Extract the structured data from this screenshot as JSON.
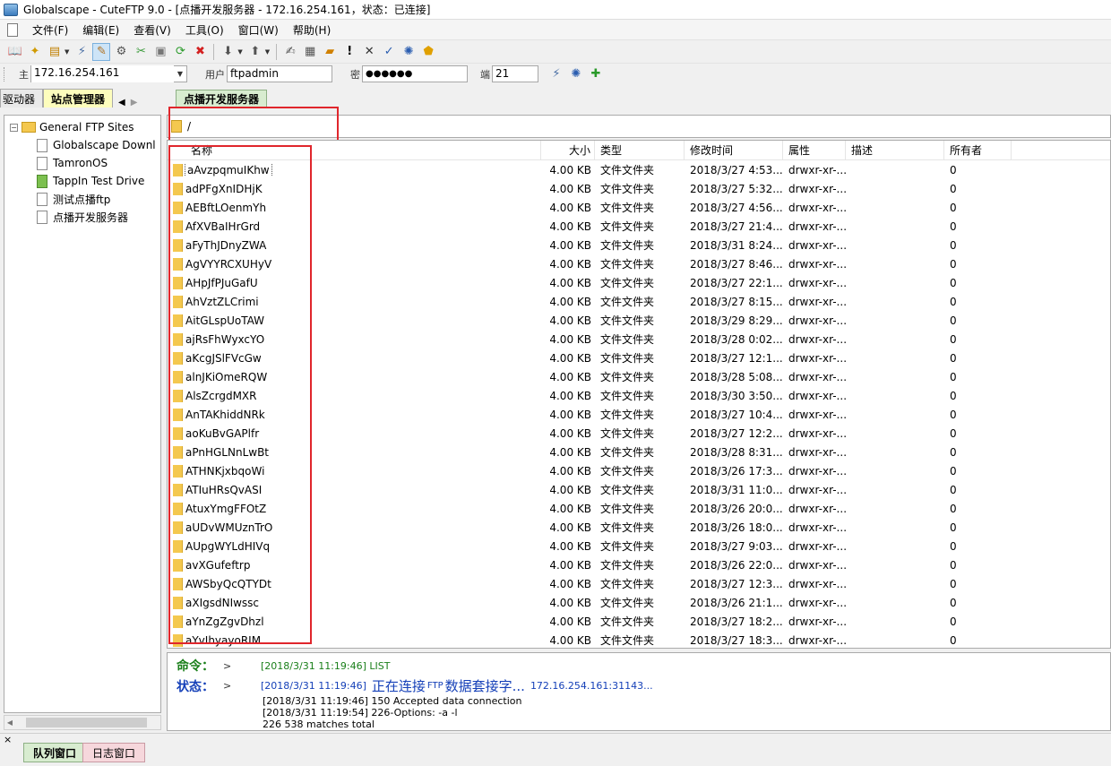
{
  "window": {
    "title": "Globalscape - CuteFTP 9.0 - [点播开发服务器 - 172.16.254.161，状态：已连接]"
  },
  "menu": {
    "items": [
      "文件(F)",
      "编辑(E)",
      "查看(V)",
      "工具(O)",
      "窗口(W)",
      "帮助(H)"
    ]
  },
  "toolbar": {
    "icons": [
      "book-icon",
      "wand-icon",
      "new-site-icon",
      "connect-icon",
      "quick-connect-icon",
      "advanced-icon",
      "tools-icon",
      "disconnect-icon",
      "refresh-icon",
      "stop-icon",
      "download-icon",
      "upload-icon",
      "edit-icon",
      "view-icon",
      "folder-new-icon",
      "exclaim-icon",
      "delete-icon",
      "properties-icon",
      "settings-icon",
      "shield-icon"
    ]
  },
  "quickconnect": {
    "host_label": "主",
    "host_value": "172.16.254.161",
    "user_label": "用户",
    "user_value": "ftpadmin",
    "password_label": "密",
    "password_value": "●●●●●●",
    "port_label": "端",
    "port_value": "21"
  },
  "left_tabs": {
    "tab1": "驱动器",
    "tab2": "站点管理器"
  },
  "tree": {
    "root": "General FTP Sites",
    "items": [
      "Globalscape Downl",
      "TamronOS",
      "TappIn Test Drive",
      "测试点播ftp",
      "点播开发服务器"
    ]
  },
  "right_tab": "点播开发服务器",
  "path": "/",
  "columns": {
    "name": "名称",
    "size": "大小",
    "type": "类型",
    "modified": "修改时间",
    "attr": "属性",
    "desc": "描述",
    "owner": "所有者"
  },
  "files": [
    {
      "name": "aAvzpqmuIKhw",
      "size": "4.00 KB",
      "type": "文件文件夹",
      "modified": "2018/3/27 4:53...",
      "attr": "drwxr-xr-...",
      "owner": "0"
    },
    {
      "name": "adPFgXnIDHjK",
      "size": "4.00 KB",
      "type": "文件文件夹",
      "modified": "2018/3/27 5:32...",
      "attr": "drwxr-xr-...",
      "owner": "0"
    },
    {
      "name": "AEBftLOenmYh",
      "size": "4.00 KB",
      "type": "文件文件夹",
      "modified": "2018/3/27 4:56...",
      "attr": "drwxr-xr-...",
      "owner": "0"
    },
    {
      "name": "AfXVBaIHrGrd",
      "size": "4.00 KB",
      "type": "文件文件夹",
      "modified": "2018/3/27 21:4...",
      "attr": "drwxr-xr-...",
      "owner": "0"
    },
    {
      "name": "aFyThJDnyZWA",
      "size": "4.00 KB",
      "type": "文件文件夹",
      "modified": "2018/3/31 8:24...",
      "attr": "drwxr-xr-...",
      "owner": "0"
    },
    {
      "name": "AgVYYRCXUHyV",
      "size": "4.00 KB",
      "type": "文件文件夹",
      "modified": "2018/3/27 8:46...",
      "attr": "drwxr-xr-...",
      "owner": "0"
    },
    {
      "name": "AHpJfPJuGafU",
      "size": "4.00 KB",
      "type": "文件文件夹",
      "modified": "2018/3/27 22:1...",
      "attr": "drwxr-xr-...",
      "owner": "0"
    },
    {
      "name": "AhVztZLCrimi",
      "size": "4.00 KB",
      "type": "文件文件夹",
      "modified": "2018/3/27 8:15...",
      "attr": "drwxr-xr-...",
      "owner": "0"
    },
    {
      "name": "AitGLspUoTAW",
      "size": "4.00 KB",
      "type": "文件文件夹",
      "modified": "2018/3/29 8:29...",
      "attr": "drwxr-xr-...",
      "owner": "0"
    },
    {
      "name": "ajRsFhWyxcYO",
      "size": "4.00 KB",
      "type": "文件文件夹",
      "modified": "2018/3/28 0:02...",
      "attr": "drwxr-xr-...",
      "owner": "0"
    },
    {
      "name": "aKcgJSlFVcGw",
      "size": "4.00 KB",
      "type": "文件文件夹",
      "modified": "2018/3/27 12:1...",
      "attr": "drwxr-xr-...",
      "owner": "0"
    },
    {
      "name": "alnJKiOmeRQW",
      "size": "4.00 KB",
      "type": "文件文件夹",
      "modified": "2018/3/28 5:08...",
      "attr": "drwxr-xr-...",
      "owner": "0"
    },
    {
      "name": "AlsZcrgdMXR",
      "size": "4.00 KB",
      "type": "文件文件夹",
      "modified": "2018/3/30 3:50...",
      "attr": "drwxr-xr-...",
      "owner": "0"
    },
    {
      "name": "AnTAKhiddNRk",
      "size": "4.00 KB",
      "type": "文件文件夹",
      "modified": "2018/3/27 10:4...",
      "attr": "drwxr-xr-...",
      "owner": "0"
    },
    {
      "name": "aoKuBvGAPlfr",
      "size": "4.00 KB",
      "type": "文件文件夹",
      "modified": "2018/3/27 12:2...",
      "attr": "drwxr-xr-...",
      "owner": "0"
    },
    {
      "name": "aPnHGLNnLwBt",
      "size": "4.00 KB",
      "type": "文件文件夹",
      "modified": "2018/3/28 8:31...",
      "attr": "drwxr-xr-...",
      "owner": "0"
    },
    {
      "name": "ATHNKjxbqoWi",
      "size": "4.00 KB",
      "type": "文件文件夹",
      "modified": "2018/3/26 17:3...",
      "attr": "drwxr-xr-...",
      "owner": "0"
    },
    {
      "name": "ATIuHRsQvASI",
      "size": "4.00 KB",
      "type": "文件文件夹",
      "modified": "2018/3/31 11:0...",
      "attr": "drwxr-xr-...",
      "owner": "0"
    },
    {
      "name": "AtuxYmgFFOtZ",
      "size": "4.00 KB",
      "type": "文件文件夹",
      "modified": "2018/3/26 20:0...",
      "attr": "drwxr-xr-...",
      "owner": "0"
    },
    {
      "name": "aUDvWMUznTrO",
      "size": "4.00 KB",
      "type": "文件文件夹",
      "modified": "2018/3/26 18:0...",
      "attr": "drwxr-xr-...",
      "owner": "0"
    },
    {
      "name": "AUpgWYLdHIVq",
      "size": "4.00 KB",
      "type": "文件文件夹",
      "modified": "2018/3/27 9:03...",
      "attr": "drwxr-xr-...",
      "owner": "0"
    },
    {
      "name": "avXGufeftrp",
      "size": "4.00 KB",
      "type": "文件文件夹",
      "modified": "2018/3/26 22:0...",
      "attr": "drwxr-xr-...",
      "owner": "0"
    },
    {
      "name": "AWSbyQcQTYDt",
      "size": "4.00 KB",
      "type": "文件文件夹",
      "modified": "2018/3/27 12:3...",
      "attr": "drwxr-xr-...",
      "owner": "0"
    },
    {
      "name": "aXIgsdNIwssc",
      "size": "4.00 KB",
      "type": "文件文件夹",
      "modified": "2018/3/26 21:1...",
      "attr": "drwxr-xr-...",
      "owner": "0"
    },
    {
      "name": "aYnZgZgvDhzl",
      "size": "4.00 KB",
      "type": "文件文件夹",
      "modified": "2018/3/27 18:2...",
      "attr": "drwxr-xr-...",
      "owner": "0"
    },
    {
      "name": "aYvIhyayoRIM",
      "size": "4.00 KB",
      "type": "文件文件夹",
      "modified": "2018/3/27 18:3...",
      "attr": "drwxr-xr-...",
      "owner": "0"
    }
  ],
  "log": {
    "cmd_label": "命令：",
    "arrow": ">",
    "cmd_text": "[2018/3/31 11:19:46] LIST",
    "status_label": "状态：",
    "status_time": "[2018/3/31 11:19:46]",
    "status_big": "正在连接",
    "status_small": "FTP",
    "status_big2": "数据套接字...",
    "status_addr": "172.16.254.161:31143...",
    "line3": "[2018/3/31 11:19:46] 150 Accepted data connection",
    "line4": "[2018/3/31 11:19:54] 226-Options: -a -l",
    "line5": "226 538 matches total"
  },
  "bottom_tabs": {
    "queue": "队列窗口",
    "log": "日志窗口",
    "close": "×"
  },
  "colors": {
    "red_annotation": "#e0262c",
    "folder": "#f4c84f",
    "status_blue": "#1540b8",
    "cmd_green": "#1a7f1a"
  }
}
